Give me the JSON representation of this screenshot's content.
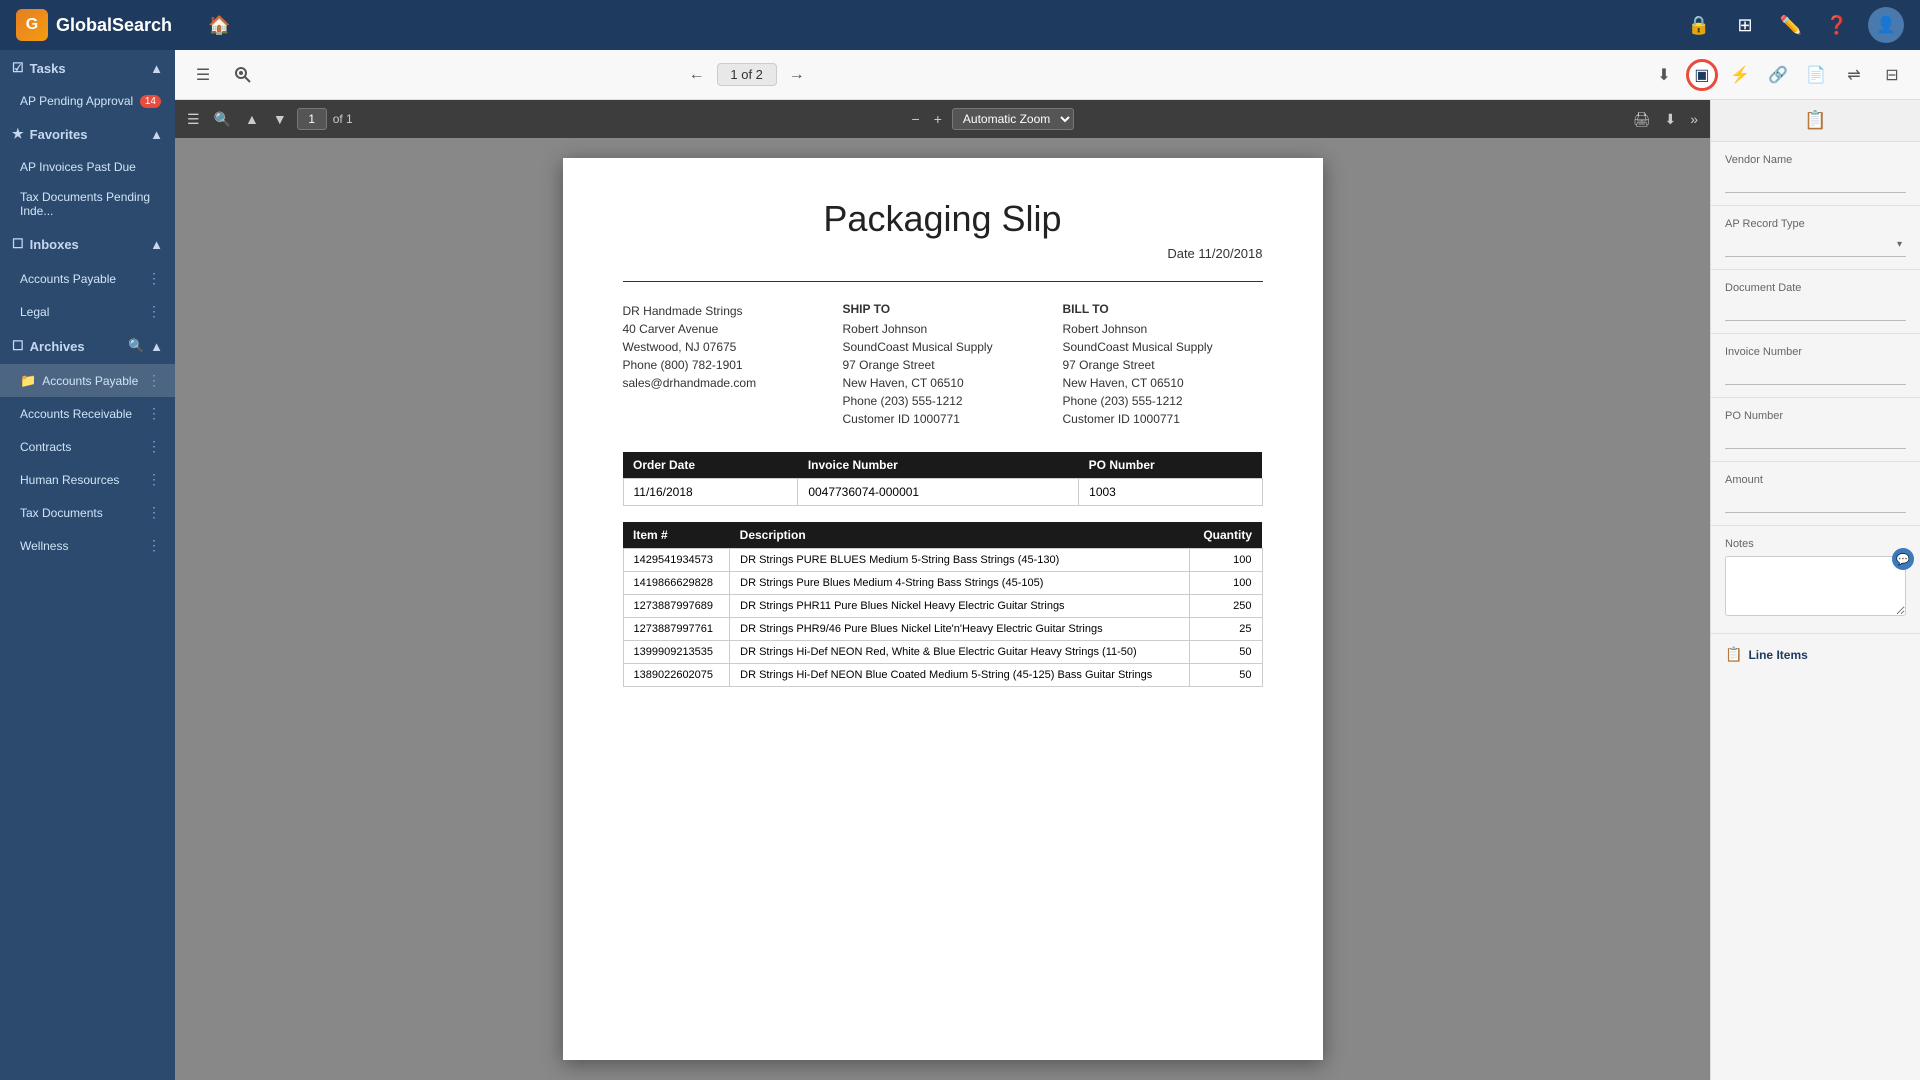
{
  "app": {
    "name": "GlobalSearch",
    "logo_letter": "G"
  },
  "top_nav": {
    "home_label": "🏠",
    "icons": [
      "🔒",
      "⊞",
      "✏️",
      "❓"
    ],
    "avatar_letter": "U"
  },
  "sidebar": {
    "tasks_label": "Tasks",
    "tasks_collapse": "▲",
    "pending_approval_label": "AP Pending Approval",
    "pending_approval_badge": "14",
    "favorites_label": "Favorites",
    "favorites_collapse": "▲",
    "favorites_items": [
      "AP Invoices Past Due",
      "Tax Documents Pending Inde..."
    ],
    "inboxes_label": "Inboxes",
    "inboxes_collapse": "▲",
    "inbox_items": [
      {
        "label": "Accounts Payable",
        "more": true
      },
      {
        "label": "Legal",
        "more": true
      }
    ],
    "archives_label": "Archives",
    "archives_collapse": "▲",
    "archives_search": true,
    "archive_items": [
      {
        "label": "Accounts Payable",
        "active": true,
        "folder": true,
        "more": true
      },
      {
        "label": "Accounts Receivable",
        "more": true
      },
      {
        "label": "Contracts",
        "more": true
      },
      {
        "label": "Human Resources",
        "more": true
      },
      {
        "label": "Tax Documents",
        "more": true
      },
      {
        "label": "Wellness",
        "more": true
      }
    ]
  },
  "toolbar": {
    "menu_icon": "☰",
    "search_icon": "⊕",
    "prev_label": "←",
    "page_indicator": "1 of 2",
    "next_label": "→",
    "right_icons": [
      {
        "id": "download",
        "icon": "⬇",
        "active": false
      },
      {
        "id": "index-card",
        "icon": "▣",
        "active": true,
        "highlighted": true
      },
      {
        "id": "lightning",
        "icon": "⚡",
        "active": false
      },
      {
        "id": "link",
        "icon": "🔗",
        "active": false
      },
      {
        "id": "file",
        "icon": "📄",
        "active": false
      },
      {
        "id": "split",
        "icon": "⇌",
        "active": false
      },
      {
        "id": "grid",
        "icon": "⊟",
        "active": false
      }
    ]
  },
  "pdf_toolbar": {
    "sidebar_icon": "☰",
    "search_icon": "🔍",
    "prev_icon": "▲",
    "next_icon": "▼",
    "page_num": "1",
    "page_total": "of 1",
    "zoom_minus": "−",
    "zoom_plus": "+",
    "zoom_label": "Automatic Zoom",
    "print_icon": "🖨",
    "download_icon": "⬇",
    "more_icon": "»"
  },
  "document": {
    "title": "Packaging Slip",
    "date_label": "Date 11/20/2018",
    "from": {
      "company": "DR Handmade Strings",
      "address": "40 Carver Avenue",
      "city": "Westwood, NJ 07675",
      "phone": "Phone (800) 782-1901",
      "email": "sales@drhandmade.com"
    },
    "ship_to": {
      "label": "SHIP TO",
      "name": "Robert Johnson",
      "company": "SoundCoast Musical Supply",
      "address": "97 Orange Street",
      "city": "New Haven, CT 06510",
      "phone": "Phone (203) 555-1212",
      "customer_id": "Customer ID 1000771"
    },
    "bill_to": {
      "label": "BILL TO",
      "name": "Robert Johnson",
      "company": "SoundCoast Musical Supply",
      "address": "97 Orange Street",
      "city": "New Haven, CT 06510",
      "phone": "Phone (203) 555-1212",
      "customer_id": "Customer ID 1000771"
    },
    "order_table": {
      "headers": [
        "Order Date",
        "Invoice Number",
        "PO Number"
      ],
      "row": [
        "11/16/2018",
        "0047736074-000001",
        "1003"
      ]
    },
    "items_table": {
      "headers": [
        "Item #",
        "Description",
        "Quantity"
      ],
      "rows": [
        {
          "item": "1429541934573",
          "desc": "DR Strings PURE BLUES Medium 5-String Bass Strings (45-130)",
          "qty": "100"
        },
        {
          "item": "1419866629828",
          "desc": "DR Strings Pure Blues Medium 4-String Bass Strings (45-105)",
          "qty": "100"
        },
        {
          "item": "1273887997689",
          "desc": "DR Strings PHR11 Pure Blues Nickel Heavy Electric Guitar Strings",
          "qty": "250"
        },
        {
          "item": "1273887997761",
          "desc": "DR Strings PHR9/46 Pure Blues Nickel Lite'n'Heavy Electric Guitar Strings",
          "qty": "25"
        },
        {
          "item": "1399909213535",
          "desc": "DR Strings Hi-Def NEON Red, White & Blue Electric Guitar Heavy Strings (11-50)",
          "qty": "50"
        },
        {
          "item": "1389022602075",
          "desc": "DR Strings Hi-Def NEON Blue Coated Medium 5-String (45-125) Bass Guitar Strings",
          "qty": "50"
        }
      ]
    }
  },
  "right_panel": {
    "header_icon": "📋",
    "fields": {
      "vendor_name_label": "Vendor Name",
      "vendor_name_value": "",
      "ap_record_type_label": "AP Record Type",
      "ap_record_type_value": "",
      "document_date_label": "Document Date",
      "document_date_value": "",
      "invoice_number_label": "Invoice Number",
      "invoice_number_value": "",
      "po_number_label": "PO Number",
      "po_number_value": "",
      "amount_label": "Amount",
      "amount_value": "",
      "notes_label": "Notes",
      "notes_value": ""
    },
    "line_items_label": "Line Items",
    "line_items_icon": "📋"
  }
}
